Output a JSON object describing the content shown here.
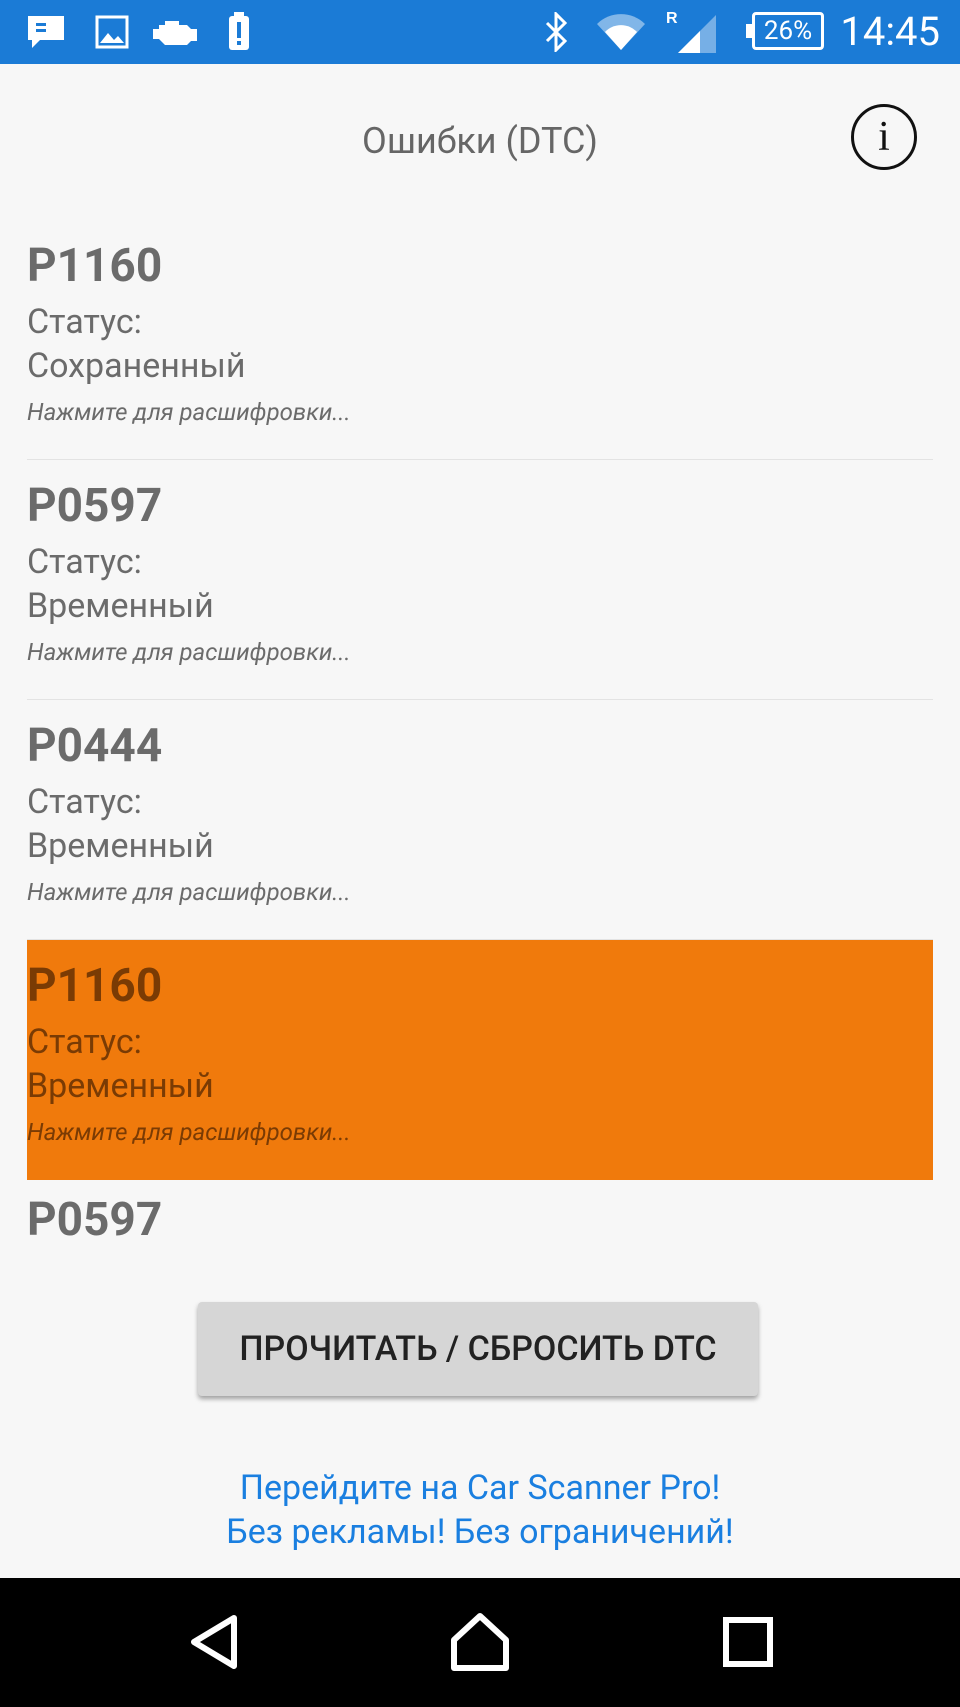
{
  "status_bar": {
    "time": "14:45",
    "battery": "26%",
    "icons": [
      "message-icon",
      "image-icon",
      "engine-icon",
      "alert-icon",
      "bluetooth-icon",
      "wifi-icon",
      "signal-roaming-icon",
      "battery-icon"
    ]
  },
  "header": {
    "title": "Ошибки (DTC)",
    "info_icon": "i"
  },
  "dtc_list": [
    {
      "code": "P1160",
      "status_label": "Статус:",
      "status": "Сохраненный",
      "hint": "Нажмите для расшифровки...",
      "selected": false
    },
    {
      "code": "P0597",
      "status_label": "Статус:",
      "status": "Временный",
      "hint": "Нажмите для расшифровки...",
      "selected": false
    },
    {
      "code": "P0444",
      "status_label": "Статус:",
      "status": "Временный",
      "hint": "Нажмите для расшифровки...",
      "selected": false
    },
    {
      "code": "P1160",
      "status_label": "Статус:",
      "status": "Временный",
      "hint": "Нажмите для расшифровки...",
      "selected": true
    }
  ],
  "dtc_partial": {
    "code": "P0597"
  },
  "main_button": {
    "label": "ПРОЧИТАТЬ / СБРОСИТЬ DTC"
  },
  "promo": {
    "line1": "Перейдите на Car Scanner Pro!",
    "line2": "Без рекламы! Без ограничений!"
  },
  "nav_bar": {
    "icons": [
      "back-icon",
      "home-icon",
      "recents-icon"
    ]
  },
  "colors": {
    "status_bar": "#1b7bd6",
    "selected_row": "#f07a0c",
    "promo_link": "#1a7fe0"
  }
}
